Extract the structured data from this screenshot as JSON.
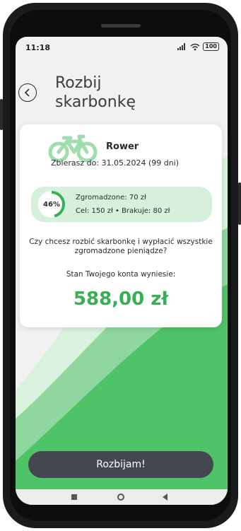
{
  "status_bar": {
    "time": "11:18",
    "signal_icon": "signal-icon",
    "wifi_icon": "wifi-icon",
    "battery": "100"
  },
  "header": {
    "back_icon": "chevron-left-icon",
    "title_line1": "Rozbij",
    "title_line2": "skarbonkę"
  },
  "goal": {
    "icon": "bicycle-icon",
    "name": "Rower",
    "date_text": "Zbierasz do: 31.05.2024 (99 dni)",
    "progress_percent": 46,
    "progress_label": "46%",
    "collected_text": "Zgromadzone: 70 zł",
    "target_text": "Cel: 150 zł • Brakuje: 80 zł"
  },
  "confirm": {
    "question": "Czy chcesz rozbić skarbonkę i wypłacić wszystkie zgromadzone pieniądze?",
    "balance_label": "Stan Twojego konta wyniesie:",
    "balance_amount": "588,00 zł"
  },
  "cta_label": "Rozbijam!",
  "colors": {
    "accent": "#35b052",
    "light_green": "#d6f0dc",
    "button": "#44474f"
  }
}
